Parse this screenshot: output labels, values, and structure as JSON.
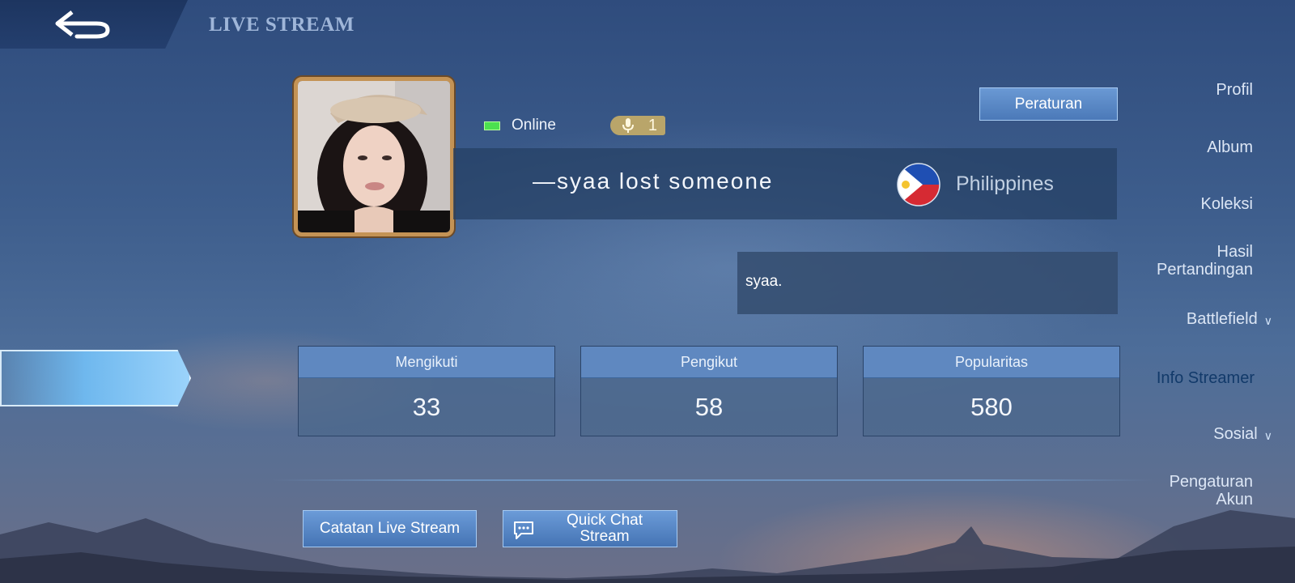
{
  "header": {
    "title": "LIVE STREAM"
  },
  "sidebar": {
    "items": [
      {
        "label": "Profil"
      },
      {
        "label": "Album"
      },
      {
        "label": "Koleksi"
      },
      {
        "label": "Hasil\nPertandingan"
      },
      {
        "label": "Battlefield",
        "expandable": true
      },
      {
        "label": "Info Streamer",
        "active": true
      },
      {
        "label": "Sosial",
        "expandable": true
      },
      {
        "label": "Pengaturan\nAkun"
      }
    ]
  },
  "profile": {
    "status": "Online",
    "mic_count": "1",
    "name": "—syaa lost someone",
    "country": "Philippines",
    "bio": "syaa."
  },
  "rules_button": "Peraturan",
  "stats": [
    {
      "label": "Mengikuti",
      "value": "33"
    },
    {
      "label": "Pengikut",
      "value": "58"
    },
    {
      "label": "Popularitas",
      "value": "580"
    }
  ],
  "actions": {
    "stream_log": "Catatan Live Stream",
    "quick_chat": "Quick Chat\nStream"
  },
  "icons": {
    "back": "back-arrow-icon",
    "mic": "microphone-icon",
    "flag": "philippines-flag-icon",
    "chat": "chat-bubble-icon",
    "chevron": "chevron-down-icon"
  },
  "colors": {
    "accent": "#5f88c0",
    "online": "#4ce04f",
    "avatar_border": "#c49355"
  }
}
